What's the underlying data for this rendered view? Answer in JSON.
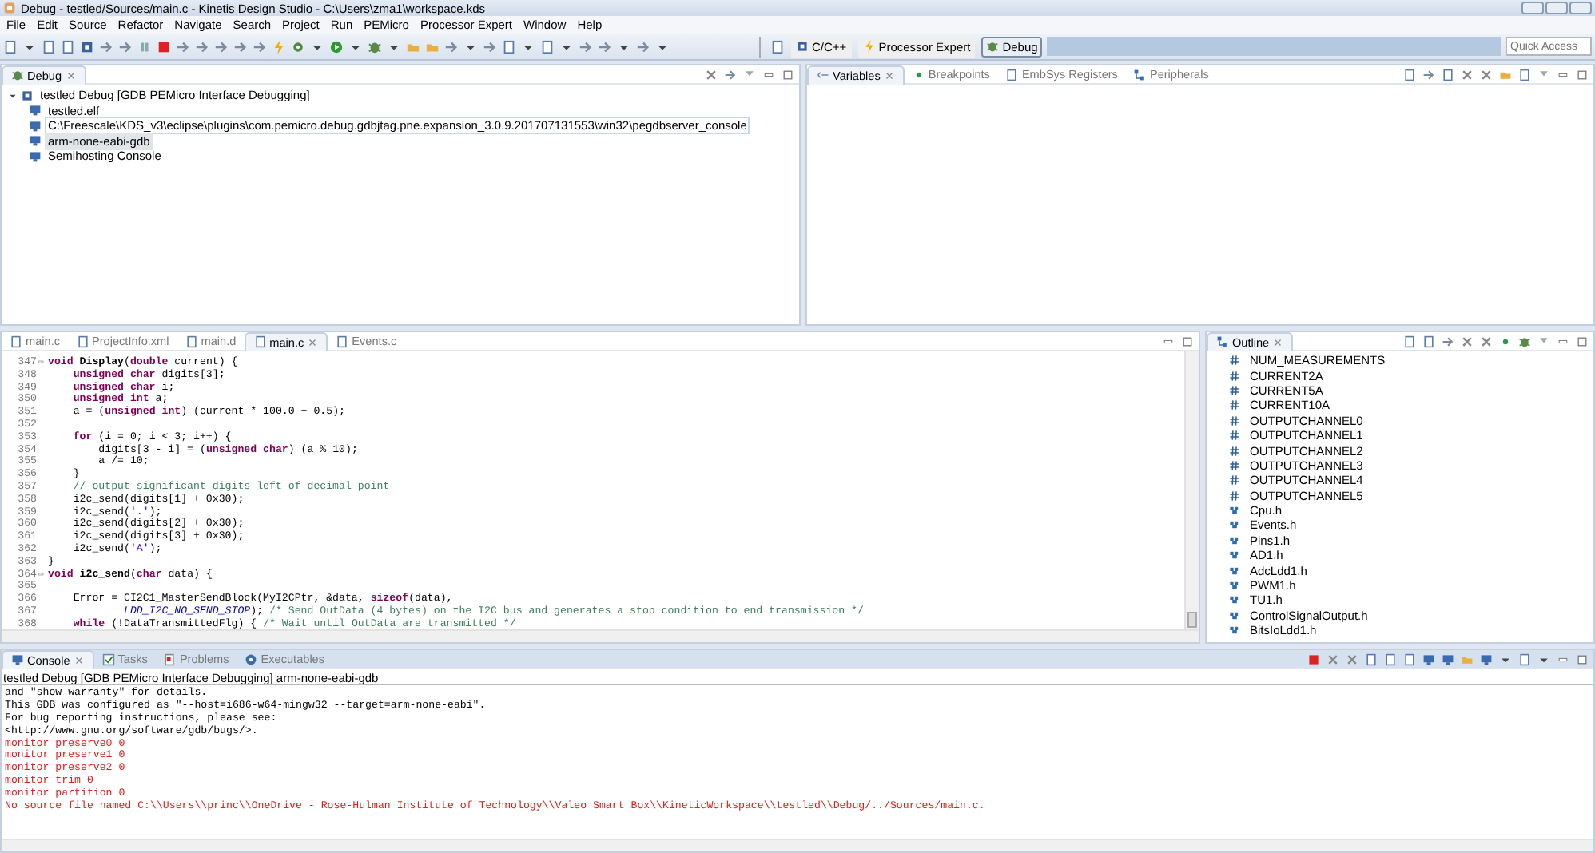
{
  "window": {
    "title": "Debug - testled/Sources/main.c - Kinetis Design Studio - C:\\Users\\zma1\\workspace.kds"
  },
  "menu": [
    "File",
    "Edit",
    "Source",
    "Refactor",
    "Navigate",
    "Search",
    "Project",
    "Run",
    "PEMicro",
    "Processor Expert",
    "Window",
    "Help"
  ],
  "perspectives": [
    {
      "label": "C/C++",
      "selected": false
    },
    {
      "label": "Processor Expert",
      "selected": false
    },
    {
      "label": "Debug",
      "selected": true
    }
  ],
  "quick_access": {
    "placeholder": "Quick Access"
  },
  "debug_view": {
    "tab": "Debug",
    "tree": [
      {
        "label": "testled Debug [GDB PEMicro Interface Debugging]",
        "expanded": true,
        "selected": false,
        "focused": false,
        "children": [
          {
            "label": "testled.elf",
            "selected": false,
            "focused": false
          },
          {
            "label": "C:\\Freescale\\KDS_v3\\eclipse\\plugins\\com.pemicro.debug.gdbjtag.pne.expansion_3.0.9.201707131553\\win32\\pegdbserver_console",
            "selected": false,
            "focused": true
          },
          {
            "label": "arm-none-eabi-gdb",
            "selected": true,
            "focused": false
          },
          {
            "label": "Semihosting Console",
            "selected": false,
            "focused": false
          }
        ]
      }
    ]
  },
  "variables_view": {
    "tabs": [
      {
        "label": "Variables",
        "selected": true
      },
      {
        "label": "Breakpoints",
        "selected": false
      },
      {
        "label": "EmbSys Registers",
        "selected": false
      },
      {
        "label": "Peripherals",
        "selected": false
      }
    ]
  },
  "editor": {
    "tabs": [
      {
        "label": "main.c",
        "selected": false
      },
      {
        "label": "ProjectInfo.xml",
        "selected": false
      },
      {
        "label": "main.d",
        "selected": false
      },
      {
        "label": "main.c",
        "selected": true
      },
      {
        "label": "Events.c",
        "selected": false
      }
    ],
    "lines": [
      {
        "number": "347",
        "fold": true,
        "tokens": [
          {
            "kind": "keyword",
            "text": "void"
          },
          {
            "kind": "name",
            "text": " Display"
          },
          {
            "kind": "plain",
            "text": "("
          },
          {
            "kind": "keyword",
            "text": "double"
          },
          {
            "kind": "plain",
            "text": " current) {"
          }
        ]
      },
      {
        "number": "348",
        "fold": false,
        "tokens": [
          {
            "kind": "keyword",
            "text": "    unsigned char"
          },
          {
            "kind": "plain",
            "text": " digits[3];"
          }
        ]
      },
      {
        "number": "349",
        "fold": false,
        "tokens": [
          {
            "kind": "keyword",
            "text": "    unsigned char"
          },
          {
            "kind": "plain",
            "text": " i;"
          }
        ]
      },
      {
        "number": "350",
        "fold": false,
        "tokens": [
          {
            "kind": "keyword",
            "text": "    unsigned int"
          },
          {
            "kind": "plain",
            "text": " a;"
          }
        ]
      },
      {
        "number": "351",
        "fold": false,
        "tokens": [
          {
            "kind": "plain",
            "text": "    a = ("
          },
          {
            "kind": "keyword",
            "text": "unsigned int"
          },
          {
            "kind": "plain",
            "text": ") (current * 100.0 + 0.5);"
          }
        ]
      },
      {
        "number": "352",
        "fold": false
      },
      {
        "number": "353",
        "fold": false,
        "tokens": [
          {
            "kind": "keyword",
            "text": "    for"
          },
          {
            "kind": "plain",
            "text": " (i = 0; i < 3; i++) {"
          }
        ]
      },
      {
        "number": "354",
        "fold": false,
        "tokens": [
          {
            "kind": "plain",
            "text": "        digits[3 - i] = ("
          },
          {
            "kind": "keyword",
            "text": "unsigned char"
          },
          {
            "kind": "plain",
            "text": ") (a % 10);"
          }
        ]
      },
      {
        "number": "355",
        "fold": false,
        "tokens": [
          {
            "kind": "plain",
            "text": "        a /= 10;"
          }
        ]
      },
      {
        "number": "356",
        "fold": false,
        "tokens": [
          {
            "kind": "plain",
            "text": "    }"
          }
        ]
      },
      {
        "number": "357",
        "fold": false,
        "tokens": [
          {
            "kind": "comment",
            "text": "    // output significant digits left of decimal point"
          }
        ]
      },
      {
        "number": "358",
        "fold": false,
        "tokens": [
          {
            "kind": "plain",
            "text": "    i2c_send(digits[1] + 0x30);"
          }
        ]
      },
      {
        "number": "359",
        "fold": false,
        "tokens": [
          {
            "kind": "plain",
            "text": "    i2c_send("
          },
          {
            "kind": "string",
            "text": "'.'"
          },
          {
            "kind": "plain",
            "text": ");"
          }
        ]
      },
      {
        "number": "360",
        "fold": false,
        "tokens": [
          {
            "kind": "plain",
            "text": "    i2c_send(digits[2] + 0x30);"
          }
        ]
      },
      {
        "number": "361",
        "fold": false,
        "tokens": [
          {
            "kind": "plain",
            "text": "    i2c_send(digits[3] + 0x30);"
          }
        ]
      },
      {
        "number": "362",
        "fold": false,
        "tokens": [
          {
            "kind": "plain",
            "text": "    i2c_send("
          },
          {
            "kind": "string",
            "text": "'A'"
          },
          {
            "kind": "plain",
            "text": ");"
          }
        ]
      },
      {
        "number": "363",
        "fold": false,
        "tokens": [
          {
            "kind": "plain",
            "text": "}"
          }
        ]
      },
      {
        "number": "364",
        "fold": true,
        "tokens": [
          {
            "kind": "keyword",
            "text": "void"
          },
          {
            "kind": "name",
            "text": " i2c_send"
          },
          {
            "kind": "plain",
            "text": "("
          },
          {
            "kind": "keyword",
            "text": "char"
          },
          {
            "kind": "plain",
            "text": " data) {"
          }
        ]
      },
      {
        "number": "365",
        "fold": false
      },
      {
        "number": "366",
        "fold": false,
        "tokens": [
          {
            "kind": "plain",
            "text": "    Error = CI2C1_MasterSendBlock(MyI2CPtr, &data, "
          },
          {
            "kind": "keyword",
            "text": "sizeof"
          },
          {
            "kind": "plain",
            "text": "(data),"
          }
        ]
      },
      {
        "number": "367",
        "fold": false,
        "tokens": [
          {
            "kind": "macro",
            "text": "            LDD_I2C_NO_SEND_STOP"
          },
          {
            "kind": "plain",
            "text": "); "
          },
          {
            "kind": "comment",
            "text": "/* Send OutData (4 bytes) on the I2C bus and generates a stop condition to end transmission */"
          }
        ]
      },
      {
        "number": "368",
        "fold": false,
        "tokens": [
          {
            "kind": "keyword",
            "text": "    while"
          },
          {
            "kind": "plain",
            "text": " (!DataTransmittedFlg) { "
          },
          {
            "kind": "comment",
            "text": "/* Wait until OutData are transmitted */"
          }
        ]
      }
    ]
  },
  "outline": {
    "tab": "Outline",
    "items": [
      {
        "kind": "define",
        "label": "NUM_MEASUREMENTS"
      },
      {
        "kind": "define",
        "label": "CURRENT2A"
      },
      {
        "kind": "define",
        "label": "CURRENT5A"
      },
      {
        "kind": "define",
        "label": "CURRENT10A"
      },
      {
        "kind": "define",
        "label": "OUTPUTCHANNEL0"
      },
      {
        "kind": "define",
        "label": "OUTPUTCHANNEL1"
      },
      {
        "kind": "define",
        "label": "OUTPUTCHANNEL2"
      },
      {
        "kind": "define",
        "label": "OUTPUTCHANNEL3"
      },
      {
        "kind": "define",
        "label": "OUTPUTCHANNEL4"
      },
      {
        "kind": "define",
        "label": "OUTPUTCHANNEL5"
      },
      {
        "kind": "include",
        "label": "Cpu.h"
      },
      {
        "kind": "include",
        "label": "Events.h"
      },
      {
        "kind": "include",
        "label": "Pins1.h"
      },
      {
        "kind": "include",
        "label": "AD1.h"
      },
      {
        "kind": "include",
        "label": "AdcLdd1.h"
      },
      {
        "kind": "include",
        "label": "PWM1.h"
      },
      {
        "kind": "include",
        "label": "TU1.h"
      },
      {
        "kind": "include",
        "label": "ControlSignalOutput.h"
      },
      {
        "kind": "include",
        "label": "BitsIoLdd1.h"
      }
    ]
  },
  "console": {
    "tabs": [
      {
        "label": "Console",
        "selected": true
      },
      {
        "label": "Tasks",
        "selected": false
      },
      {
        "label": "Problems",
        "selected": false
      },
      {
        "label": "Executables",
        "selected": false
      }
    ],
    "header": "testled Debug [GDB PEMicro Interface Debugging] arm-none-eabi-gdb",
    "lines": [
      {
        "kind": "output",
        "text": "and \"show warranty\" for details."
      },
      {
        "kind": "output",
        "text": "This GDB was configured as \"--host=i686-w64-mingw32 --target=arm-none-eabi\"."
      },
      {
        "kind": "output",
        "text": "For bug reporting instructions, please see:"
      },
      {
        "kind": "output",
        "text": "<http://www.gnu.org/software/gdb/bugs/>."
      },
      {
        "kind": "error",
        "text": "monitor preserve0 0"
      },
      {
        "kind": "error",
        "text": "monitor preserve1 0"
      },
      {
        "kind": "error",
        "text": "monitor preserve2 0"
      },
      {
        "kind": "error",
        "text": "monitor trim 0"
      },
      {
        "kind": "error",
        "text": "monitor partition 0"
      },
      {
        "kind": "error",
        "text": "No source file named C:\\\\Users\\\\princ\\\\OneDrive - Rose-Hulman Institute of Technology\\\\Valeo Smart Box\\\\KineticWorkspace\\\\testled\\\\Debug/../Sources/main.c."
      }
    ]
  }
}
